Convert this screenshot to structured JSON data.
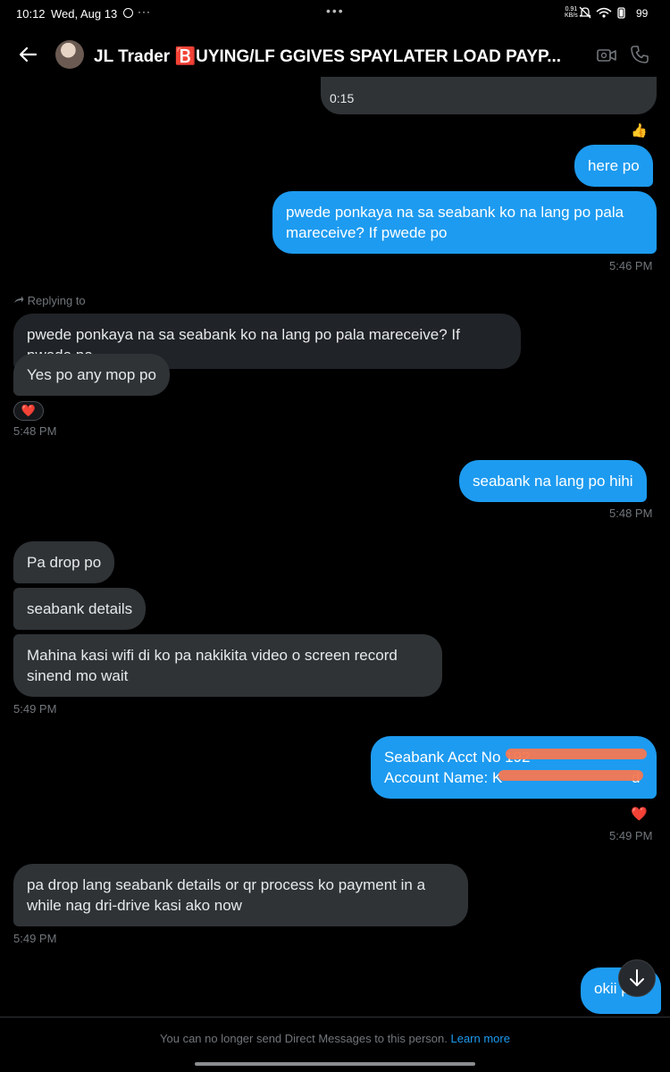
{
  "status_bar": {
    "time": "10:12",
    "date": "Wed, Aug 13",
    "dots": "···",
    "center": "•••",
    "speed_value": "0.91",
    "speed_unit": "KB/s",
    "battery": "99"
  },
  "header": {
    "title": "JL Trader 🅱️UYING/LF GGIVES SPAYLATER LOAD PAYP..."
  },
  "messages": {
    "audio_time": "0:15",
    "thumbs_reaction": "👍",
    "here_po": "here po",
    "seabank_ask": "pwede ponkaya na sa seabank ko na lang po pala mareceive? If pwede po",
    "ts_546": "5:46 PM",
    "replying_to": "Replying to",
    "quoted_text": "pwede ponkaya na sa seabank ko na lang po pala mareceive? If pwede po",
    "yes_po": "Yes po any mop po",
    "heart_reaction": "❤️",
    "ts_548a": "5:48 PM",
    "seabank_hihi": "seabank na lang po hihi",
    "ts_548b": "5:48 PM",
    "pa_drop": "Pa drop po",
    "seabank_details": "seabank details",
    "mahina_wifi": "Mahina kasi wifi di ko pa nakikita video o screen record sinend mo wait",
    "ts_549a": "5:49 PM",
    "acct_line1": "Seabank Acct No 192",
    "acct_line2": "Account Name: K",
    "acct_tail": "d",
    "heart_reaction_2": "❤️",
    "ts_549b": "5:49 PM",
    "pa_drop_lang": "pa drop lang seabank details or qr process ko payment in a while nag dri-drive kasi ako now",
    "ts_549c": "5:49 PM",
    "okii": "okii p"
  },
  "footer": {
    "notice": "You can no longer send Direct Messages to this person.",
    "learn_more": "Learn more"
  },
  "colors": {
    "sent_bubble": "#1d9bf0",
    "recv_bubble": "#2f3336",
    "background": "#000000",
    "muted_text": "#71767b",
    "redaction": "#f47852"
  }
}
